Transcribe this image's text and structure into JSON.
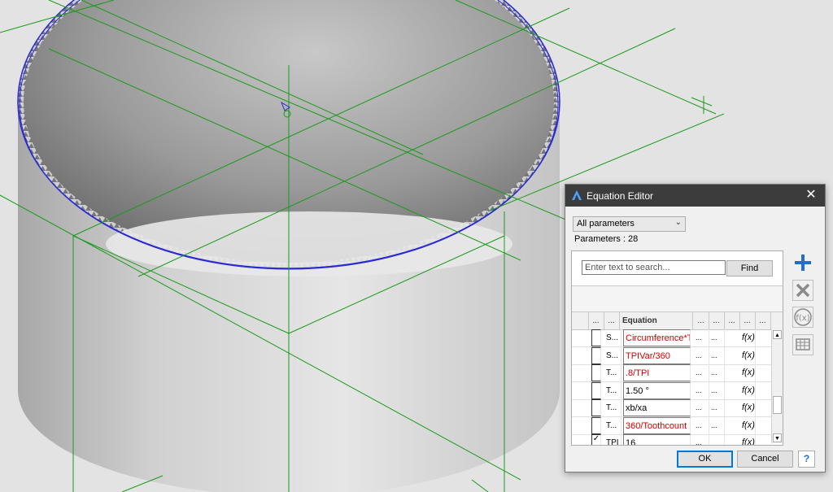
{
  "dialog": {
    "title": "Equation Editor",
    "close_glyph": "✕",
    "filter_value": "All parameters",
    "parameters_label": "Parameters : ",
    "parameters_count": "28",
    "search_placeholder": "Enter text to search...",
    "find_label": "Find",
    "columns": [
      "...",
      "...",
      "Equation",
      "...",
      "...",
      "...",
      "...",
      "..."
    ],
    "rows": [
      {
        "checked": false,
        "name": "S...",
        "equation": "Circumference*TF",
        "equation_color": "red",
        "c1": "...",
        "c2": "...",
        "fx": "f(x)"
      },
      {
        "checked": false,
        "name": "S...",
        "equation": "TPIVar/360",
        "equation_color": "red",
        "c1": "...",
        "c2": "...",
        "fx": "f(x)"
      },
      {
        "checked": false,
        "name": "T...",
        "equation": ".8/TPI",
        "equation_color": "red",
        "c1": "...",
        "c2": "...",
        "fx": "f(x)"
      },
      {
        "checked": false,
        "name": "T...",
        "equation": "1.50 °",
        "equation_color": "black",
        "c1": "...",
        "c2": "...",
        "fx": "f(x)"
      },
      {
        "checked": false,
        "name": "T...",
        "equation": "xb/xa",
        "equation_color": "black",
        "c1": "...",
        "c2": "...",
        "fx": "f(x)"
      },
      {
        "checked": false,
        "name": "T...",
        "equation": "360/Toothcount",
        "equation_color": "red",
        "c1": "...",
        "c2": "...",
        "fx": "f(x)"
      },
      {
        "checked": true,
        "name": "TPI",
        "equation": "16",
        "equation_color": "black",
        "c1": "...",
        "c2": "",
        "fx": "f(x)"
      }
    ],
    "side_buttons": [
      {
        "name": "add-parameter-button",
        "icon": "plus-icon",
        "color": "#1e6fd0"
      },
      {
        "name": "delete-parameter-button",
        "icon": "x-icon",
        "color": "#8a8a8a"
      },
      {
        "name": "function-button",
        "icon": "fx-icon",
        "color": "#8a8a8a"
      },
      {
        "name": "table-button",
        "icon": "table-icon",
        "color": "#8a8a8a"
      }
    ],
    "ok_label": "OK",
    "cancel_label": "Cancel",
    "help_label": "?"
  },
  "colors": {
    "accent": "#0078d7",
    "sketch_lines": "#1a9a1a",
    "selected_edge": "#2a2ad4",
    "titlebar": "#3c3c3c"
  }
}
